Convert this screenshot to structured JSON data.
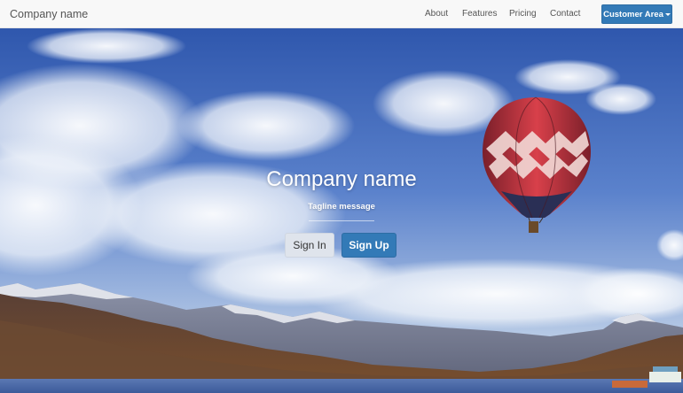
{
  "navbar": {
    "brand": "Company name",
    "links": [
      {
        "label": "About"
      },
      {
        "label": "Features"
      },
      {
        "label": "Pricing"
      },
      {
        "label": "Contact"
      }
    ],
    "customer_area_label": "Customer Area"
  },
  "hero": {
    "title": "Company name",
    "tagline": "Tagline message",
    "signin_label": "Sign In",
    "signup_label": "Sign Up"
  },
  "colors": {
    "primary": "#337ab7",
    "navbar_bg": "#f8f8f8",
    "navbar_text": "#555555",
    "sky": "#3f67b8",
    "secondary_button": "#dfe4ec"
  }
}
